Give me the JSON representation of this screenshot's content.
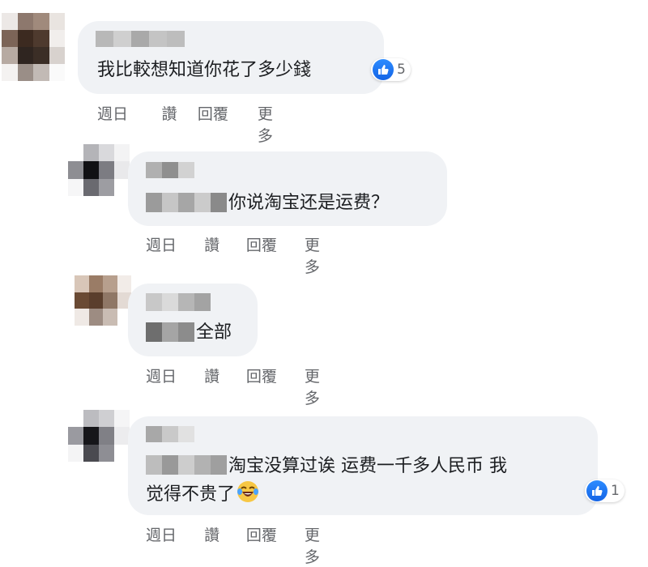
{
  "comments": [
    {
      "text": "我比較想知道你花了多少錢",
      "reaction": {
        "icon": "thumbs-up-icon",
        "count": "5"
      },
      "actions": {
        "time": "週日",
        "like": "讚",
        "reply": "回覆",
        "more": "更多"
      }
    },
    {
      "text": "你说淘宝还是运费？",
      "actions": {
        "time": "週日",
        "like": "讚",
        "reply": "回覆",
        "more": "更多"
      }
    },
    {
      "text": "全部",
      "actions": {
        "time": "週日",
        "like": "讚",
        "reply": "回覆",
        "more": "更多"
      }
    },
    {
      "text_line1": "淘宝没算过诶 运费一千多人民币 我",
      "text_line2": "觉得不贵了",
      "emoji": "tears-of-joy-emoji",
      "reaction": {
        "icon": "thumbs-up-icon",
        "count": "1"
      },
      "actions": {
        "time": "週日",
        "like": "讚",
        "reply": "回覆",
        "more": "更多"
      }
    }
  ]
}
